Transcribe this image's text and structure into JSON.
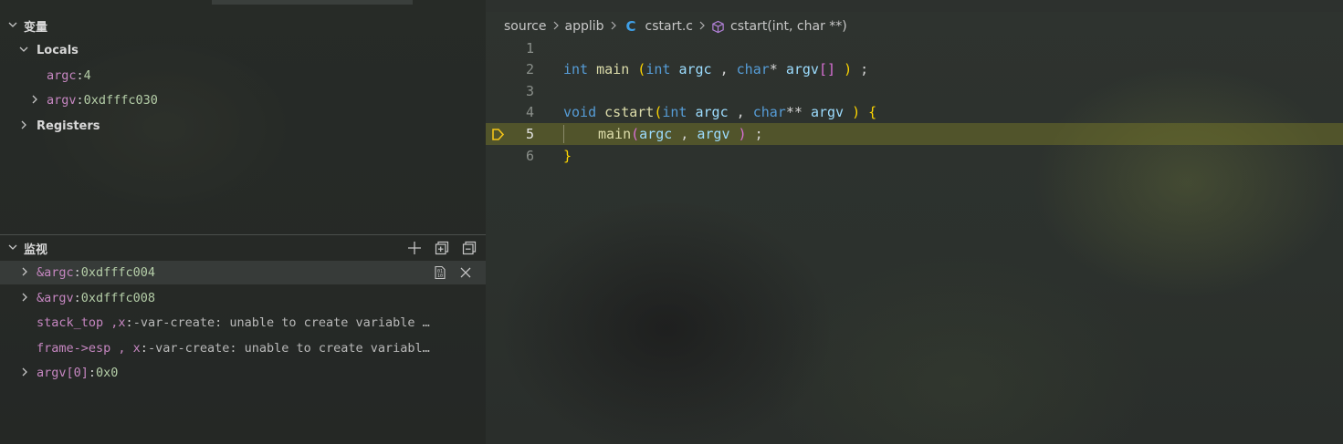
{
  "variables": {
    "title": "变量",
    "locals_label": "Locals",
    "locals": [
      {
        "name": "argc",
        "sep": ": ",
        "value": "4",
        "expandable": false
      },
      {
        "name": "argv",
        "sep": ": ",
        "value": "0xdfffc030",
        "expandable": true
      }
    ],
    "registers_label": "Registers"
  },
  "watch": {
    "title": "监视",
    "items": [
      {
        "name": "&argc",
        "sep": ": ",
        "value": "0xdfffc004",
        "expandable": true
      },
      {
        "name": "&argv",
        "sep": ": ",
        "value": "0xdfffc008",
        "expandable": true
      },
      {
        "name": "stack_top ,x",
        "sep": " : ",
        "value": "-var-create: unable to create variable …",
        "expandable": false
      },
      {
        "name": "frame->esp , x",
        "sep": " : ",
        "value": "-var-create: unable to create variabl…",
        "expandable": false
      },
      {
        "name": "argv[0]",
        "sep": ": ",
        "value": "0x0",
        "expandable": true
      }
    ]
  },
  "breadcrumb": {
    "parts": [
      "source",
      "applib",
      "cstart.c",
      "cstart(int, char **)"
    ],
    "file_icon": "c-language-icon",
    "symbol_icon": "method-cube-icon"
  },
  "editor": {
    "line_numbers": [
      "1",
      "2",
      "3",
      "4",
      "5",
      "6"
    ],
    "current_line": "5",
    "line2": {
      "t1": "int",
      "t2": "main",
      "t3": "(",
      "t4": "int",
      "t5": "argc",
      "t6": " , ",
      "t7": "char",
      "t8": "*",
      "t9": "argv",
      "t10": "[]",
      "t11": ")",
      "t12": " ;"
    },
    "line4": {
      "t1": "void",
      "t2": "cstart",
      "t3": "(",
      "t4": "int",
      "t5": "argc",
      "t6": " , ",
      "t7": "char",
      "t8": "**",
      "t9": "argv",
      "t10": ")",
      "t11": "{"
    },
    "line5": {
      "t1": "main",
      "t2": "(",
      "t3": "argc",
      "t4": " , ",
      "t5": "argv",
      "t6": ")",
      "t7": " ;"
    },
    "line6": {
      "t1": "}"
    }
  },
  "colors": {
    "keyword": "#569cd6",
    "function": "#dcdcaa",
    "parameter": "#9cdcfe",
    "bracket_gold": "#ffd700",
    "bracket_purple": "#da70d6",
    "current_line_highlight": "#82822a",
    "breakpoint_arrow": "#f5c518"
  }
}
